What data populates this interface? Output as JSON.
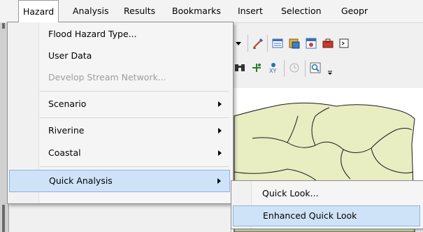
{
  "menubar": {
    "items": [
      "Hazard",
      "Analysis",
      "Results",
      "Bookmarks",
      "Insert",
      "Selection",
      "Geopr"
    ],
    "active": "Hazard"
  },
  "hazard_menu": {
    "items": [
      {
        "label": "Flood Hazard Type...",
        "enabled": true,
        "submenu": false
      },
      {
        "label": "User Data",
        "enabled": true,
        "submenu": false
      },
      {
        "label": "Develop Stream Network...",
        "enabled": false,
        "submenu": false
      },
      {
        "label": "Scenario",
        "enabled": true,
        "submenu": true
      },
      {
        "label": "Riverine",
        "enabled": true,
        "submenu": true
      },
      {
        "label": "Coastal",
        "enabled": true,
        "submenu": true
      },
      {
        "label": "Quick Analysis",
        "enabled": true,
        "submenu": true,
        "highlighted": true
      }
    ]
  },
  "quick_analysis_submenu": {
    "items": [
      {
        "label": "Quick Look...",
        "highlighted": false
      },
      {
        "label": "Enhanced Quick Look",
        "highlighted": true
      }
    ]
  },
  "toolbar_icons": [
    "dropdown-icon",
    "edit-sketch-icon",
    "table-window-icon",
    "python-icon",
    "arc-catalog-icon",
    "toolbox-icon",
    "command-line-icon",
    "find-binoculars-icon",
    "go-to-xy-icon",
    "measure-xy-icon",
    "time-slider-icon",
    "zoom-to-layer-icon",
    "toolbar-overflow-icon"
  ],
  "colors": {
    "highlight_fill": "#cfe3f8",
    "highlight_border": "#8db2e3",
    "map_polygon_fill": "#e8edc2",
    "map_outline": "#1a1a1a",
    "disabled_text": "#9d9d9d"
  }
}
